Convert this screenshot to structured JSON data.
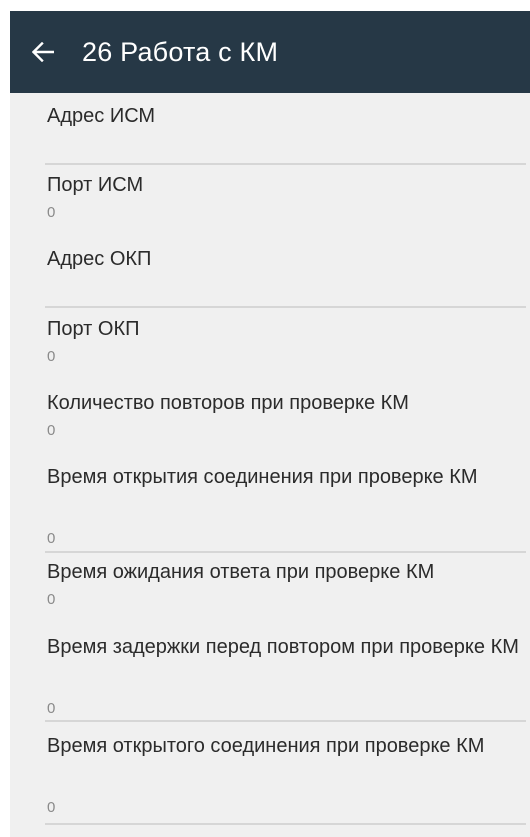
{
  "toolbar": {
    "title": "26 Работа с КМ",
    "background": "#263846"
  },
  "items": [
    {
      "label": "Адрес ИСМ",
      "value": ""
    },
    {
      "label": "Порт ИСМ",
      "value": "0"
    },
    {
      "label": "Адрес ОКП",
      "value": ""
    },
    {
      "label": "Порт ОКП",
      "value": "0"
    },
    {
      "label": "Количество повторов при проверке КМ",
      "value": "0"
    },
    {
      "label": "Время открытия соединения при проверке КМ",
      "value": "0"
    },
    {
      "label": "Время ожидания ответа при проверке КМ",
      "value": "0"
    },
    {
      "label": "Время задержки перед повтором при проверке КМ",
      "value": "0"
    },
    {
      "label": "Время открытого соединения при проверке КМ",
      "value": "0"
    }
  ]
}
